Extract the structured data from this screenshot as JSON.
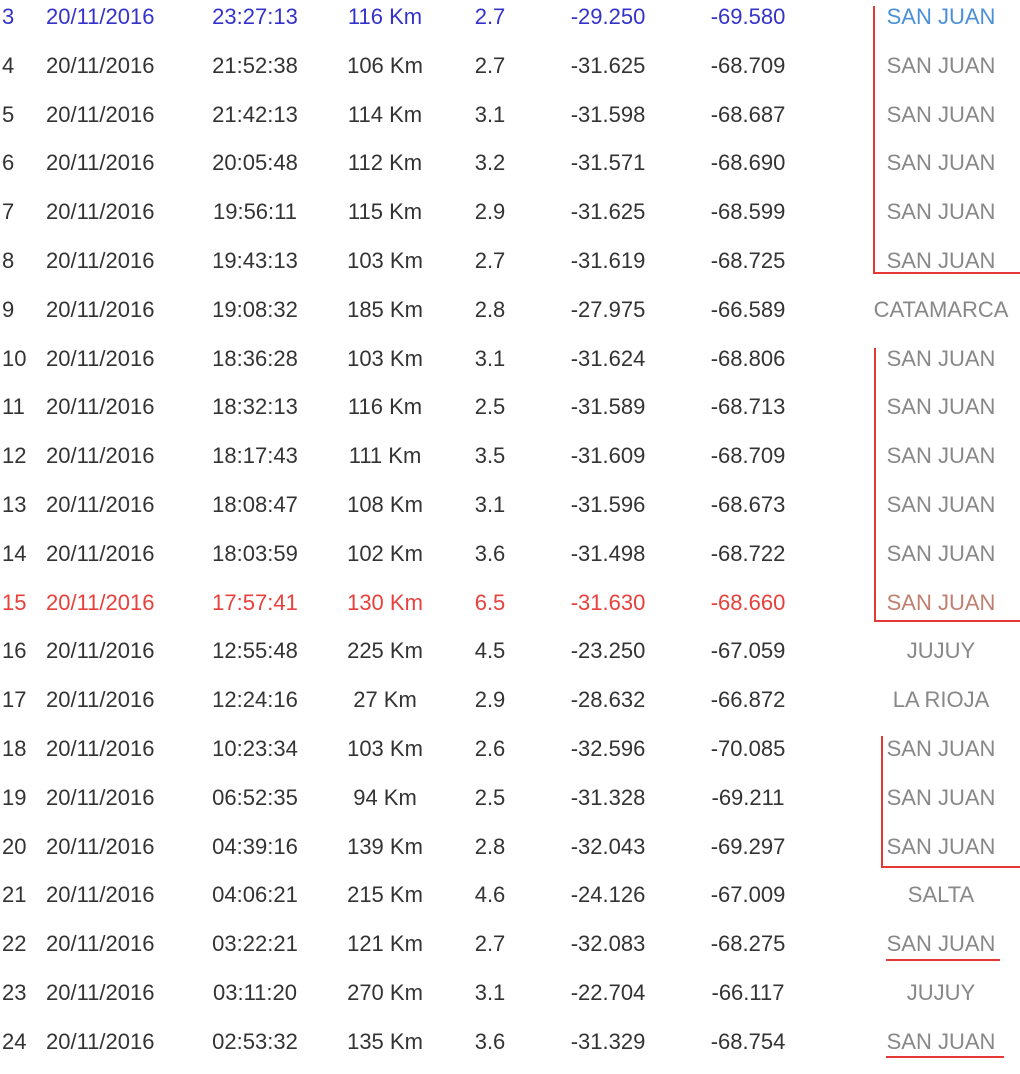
{
  "rows": [
    {
      "num": "3",
      "date": "20/11/2016",
      "time": "23:27:13",
      "depth": "116 Km",
      "mag": "2.7",
      "lat": "-29.250",
      "lon": "-69.580",
      "province": "SAN JUAN",
      "style": "blue"
    },
    {
      "num": "4",
      "date": "20/11/2016",
      "time": "21:52:38",
      "depth": "106 Km",
      "mag": "2.7",
      "lat": "-31.625",
      "lon": "-68.709",
      "province": "SAN JUAN",
      "style": "normal"
    },
    {
      "num": "5",
      "date": "20/11/2016",
      "time": "21:42:13",
      "depth": "114 Km",
      "mag": "3.1",
      "lat": "-31.598",
      "lon": "-68.687",
      "province": "SAN JUAN",
      "style": "normal"
    },
    {
      "num": "6",
      "date": "20/11/2016",
      "time": "20:05:48",
      "depth": "112 Km",
      "mag": "3.2",
      "lat": "-31.571",
      "lon": "-68.690",
      "province": "SAN JUAN",
      "style": "normal"
    },
    {
      "num": "7",
      "date": "20/11/2016",
      "time": "19:56:11",
      "depth": "115 Km",
      "mag": "2.9",
      "lat": "-31.625",
      "lon": "-68.599",
      "province": "SAN JUAN",
      "style": "normal"
    },
    {
      "num": "8",
      "date": "20/11/2016",
      "time": "19:43:13",
      "depth": "103 Km",
      "mag": "2.7",
      "lat": "-31.619",
      "lon": "-68.725",
      "province": "SAN JUAN",
      "style": "normal"
    },
    {
      "num": "9",
      "date": "20/11/2016",
      "time": "19:08:32",
      "depth": "185 Km",
      "mag": "2.8",
      "lat": "-27.975",
      "lon": "-66.589",
      "province": "CATAMARCA",
      "style": "normal"
    },
    {
      "num": "10",
      "date": "20/11/2016",
      "time": "18:36:28",
      "depth": "103 Km",
      "mag": "3.1",
      "lat": "-31.624",
      "lon": "-68.806",
      "province": "SAN JUAN",
      "style": "normal"
    },
    {
      "num": "11",
      "date": "20/11/2016",
      "time": "18:32:13",
      "depth": "116 Km",
      "mag": "2.5",
      "lat": "-31.589",
      "lon": "-68.713",
      "province": "SAN JUAN",
      "style": "normal"
    },
    {
      "num": "12",
      "date": "20/11/2016",
      "time": "18:17:43",
      "depth": "111 Km",
      "mag": "3.5",
      "lat": "-31.609",
      "lon": "-68.709",
      "province": "SAN JUAN",
      "style": "normal"
    },
    {
      "num": "13",
      "date": "20/11/2016",
      "time": "18:08:47",
      "depth": "108 Km",
      "mag": "3.1",
      "lat": "-31.596",
      "lon": "-68.673",
      "province": "SAN JUAN",
      "style": "normal"
    },
    {
      "num": "14",
      "date": "20/11/2016",
      "time": "18:03:59",
      "depth": "102 Km",
      "mag": "3.6",
      "lat": "-31.498",
      "lon": "-68.722",
      "province": "SAN JUAN",
      "style": "normal"
    },
    {
      "num": "15",
      "date": "20/11/2016",
      "time": "17:57:41",
      "depth": "130 Km",
      "mag": "6.5",
      "lat": "-31.630",
      "lon": "-68.660",
      "province": "SAN JUAN",
      "style": "red"
    },
    {
      "num": "16",
      "date": "20/11/2016",
      "time": "12:55:48",
      "depth": "225 Km",
      "mag": "4.5",
      "lat": "-23.250",
      "lon": "-67.059",
      "province": "JUJUY",
      "style": "normal"
    },
    {
      "num": "17",
      "date": "20/11/2016",
      "time": "12:24:16",
      "depth": "27 Km",
      "mag": "2.9",
      "lat": "-28.632",
      "lon": "-66.872",
      "province": "LA RIOJA",
      "style": "normal"
    },
    {
      "num": "18",
      "date": "20/11/2016",
      "time": "10:23:34",
      "depth": "103 Km",
      "mag": "2.6",
      "lat": "-32.596",
      "lon": "-70.085",
      "province": "SAN JUAN",
      "style": "normal"
    },
    {
      "num": "19",
      "date": "20/11/2016",
      "time": "06:52:35",
      "depth": "94 Km",
      "mag": "2.5",
      "lat": "-31.328",
      "lon": "-69.211",
      "province": "SAN JUAN",
      "style": "normal"
    },
    {
      "num": "20",
      "date": "20/11/2016",
      "time": "04:39:16",
      "depth": "139 Km",
      "mag": "2.8",
      "lat": "-32.043",
      "lon": "-69.297",
      "province": "SAN JUAN",
      "style": "normal"
    },
    {
      "num": "21",
      "date": "20/11/2016",
      "time": "04:06:21",
      "depth": "215 Km",
      "mag": "4.6",
      "lat": "-24.126",
      "lon": "-67.009",
      "province": "SALTA",
      "style": "normal"
    },
    {
      "num": "22",
      "date": "20/11/2016",
      "time": "03:22:21",
      "depth": "121 Km",
      "mag": "2.7",
      "lat": "-32.083",
      "lon": "-68.275",
      "province": "SAN JUAN",
      "style": "normal"
    },
    {
      "num": "23",
      "date": "20/11/2016",
      "time": "03:11:20",
      "depth": "270 Km",
      "mag": "3.1",
      "lat": "-22.704",
      "lon": "-66.117",
      "province": "JUJUY",
      "style": "normal"
    },
    {
      "num": "24",
      "date": "20/11/2016",
      "time": "02:53:32",
      "depth": "135 Km",
      "mag": "3.6",
      "lat": "-31.329",
      "lon": "-68.754",
      "province": "SAN JUAN",
      "style": "normal"
    }
  ],
  "annotation_color": "#e53935"
}
